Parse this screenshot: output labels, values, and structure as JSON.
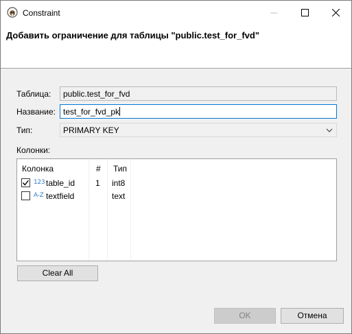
{
  "window": {
    "title": "Constraint",
    "icon": "dbeaver-beaver-icon"
  },
  "header": {
    "title": "Добавить ограничение для таблицы \"public.test_for_fvd\""
  },
  "form": {
    "table_label": "Таблица:",
    "table_value": "public.test_for_fvd",
    "name_label": "Название:",
    "name_value": "test_for_fvd_pk",
    "type_label": "Тип:",
    "type_value": "PRIMARY KEY",
    "columns_label": "Колонки:"
  },
  "columns_table": {
    "headers": {
      "column": "Колонка",
      "num": "#",
      "type": "Тип"
    },
    "rows": [
      {
        "checked": true,
        "type_icon": "123",
        "name": "table_id",
        "num": "1",
        "type": "int8"
      },
      {
        "checked": false,
        "type_icon": "A-Z",
        "name": "textfield",
        "num": "",
        "type": "text"
      }
    ]
  },
  "buttons": {
    "clear_all": "Clear All",
    "ok": "OK",
    "cancel": "Отмена"
  },
  "colors": {
    "accent": "#0078d7",
    "type_icon": "#2e7dc7"
  }
}
